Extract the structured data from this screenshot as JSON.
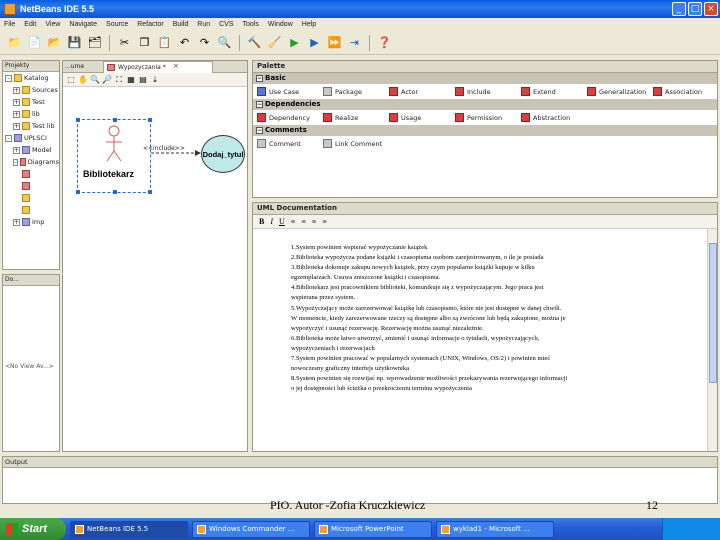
{
  "window": {
    "title": "NetBeans IDE 5.5",
    "min": "_",
    "max": "□",
    "close": "×"
  },
  "menu": [
    "File",
    "Edit",
    "View",
    "Navigate",
    "Source",
    "Refactor",
    "Build",
    "Run",
    "CVS",
    "Tools",
    "Window",
    "Help"
  ],
  "toolbar": {
    "icons": [
      "new-project-icon",
      "new-file-icon",
      "open-project-icon",
      "save-icon",
      "save-all-icon",
      "cut-icon",
      "copy-icon",
      "paste-icon",
      "undo-icon",
      "redo-icon",
      "find-icon",
      "build-icon",
      "clean-build-icon",
      "run-icon",
      "debug-icon",
      "profile-icon",
      "step-icon",
      "help-icon"
    ]
  },
  "projects": {
    "header": "Projekty",
    "rows": [
      {
        "exp": "-",
        "icon": "folder",
        "label": "Katalog"
      },
      {
        "exp": "+",
        "icon": "folder",
        "label": "Sources"
      },
      {
        "exp": "+",
        "icon": "folder",
        "label": "Test"
      },
      {
        "exp": "+",
        "icon": "folder",
        "label": "lib"
      },
      {
        "exp": "+",
        "icon": "folder",
        "label": "Test lib"
      },
      {
        "exp": "-",
        "icon": "pkg",
        "label": "UPLSCI"
      },
      {
        "exp": "+",
        "icon": "pkg",
        "label": "Model"
      },
      {
        "exp": "-",
        "icon": "diag",
        "label": "Diagrams"
      },
      {
        "exp": "",
        "icon": "diag",
        "label": ""
      },
      {
        "exp": "",
        "icon": "diag",
        "label": ""
      },
      {
        "exp": "",
        "icon": "folder",
        "label": ""
      },
      {
        "exp": "",
        "icon": "folder",
        "label": ""
      },
      {
        "exp": "+",
        "icon": "pkg",
        "label": "Imp"
      }
    ]
  },
  "navigator": {
    "header": "Do...",
    "empty": "<No View Av...>"
  },
  "editor": {
    "tab_left": "...ume",
    "tab_label": "Wypozyczania *",
    "tab_close": "×",
    "diagram": {
      "actor": "Bibliotekarz",
      "relation": "<<include>>",
      "usecase": "Dodaj_tytul"
    }
  },
  "palette": {
    "title": "Palette",
    "categories": [
      {
        "name": "Basic",
        "items": [
          {
            "label": "Use Case",
            "icon": "blue"
          },
          {
            "label": "Package",
            "icon": "gray"
          },
          {
            "label": "Actor",
            "icon": "red"
          },
          {
            "label": "Include",
            "icon": "red"
          },
          {
            "label": "Extend",
            "icon": "red"
          },
          {
            "label": "Generalization",
            "icon": "red"
          },
          {
            "label": "Association",
            "icon": "red"
          }
        ]
      },
      {
        "name": "Dependencies",
        "items": [
          {
            "label": "Dependency",
            "icon": "red"
          },
          {
            "label": "Realize",
            "icon": "red"
          },
          {
            "label": "Usage",
            "icon": "red"
          },
          {
            "label": "Permission",
            "icon": "red"
          },
          {
            "label": "Abstraction",
            "icon": "red"
          }
        ]
      },
      {
        "name": "Comments",
        "items": [
          {
            "label": "Comment",
            "icon": "gray"
          },
          {
            "label": "Link Comment",
            "icon": "gray"
          }
        ]
      }
    ]
  },
  "umldoc": {
    "title": "UML Documentation",
    "format_buttons": [
      "B",
      "I",
      "U",
      "≡",
      "≡",
      "≡",
      "≡"
    ],
    "lines": [
      "1.System powinien wspierać wypożyczanie książek",
      "2.Biblioteka wypożycza podane książki i czasopisma osobom zarejestrowanym, o ile je posiada",
      "3.Biblioteka dokonuje zakupu nowych książek, przy czym popularne książki kupuje w kilku",
      "egzemplarzach. Usuwa zniszczone książki i czasopisma.",
      "4.Bibliotekarz jest pracownikiem biblioteki, komunikuje się z wypożyczającym. Jego praca jest",
      "wspierana przez system.",
      "5.Wypożyczający może zarezerwować książkę lub czasopismo, które nie jest dostępne w danej chwili.",
      "W momencie, kiedy zarezerwowane rzeczy są dostępne albo są zwrócone lub będą zakupione, można je",
      "wypożyczyć i usunąć rezerwację. Rezerwację można usunąć niezależnie.",
      "6.Biblioteka może łatwo utworzyć, zmienić i usunąć informacje o tytułach, wypożyczających,",
      "wypożyczeniach i rezerwacjach",
      "7.System powinien pracować w popularnych systemach (UNIX, Windows, OS/2) i powinien mieć",
      "nowoczesny graficzny interfejs użytkownika",
      "8.System powinien się rozwijać np. wprowadzenie możliwości przekazywania rezerwującego informacji",
      "o jej dostępności lub ścieżka o przekroczeniu terminu wypożyczenia"
    ]
  },
  "output": {
    "header": "Output"
  },
  "footer": {
    "author": "PIO. Autor -Zofia Kruczkiewicz",
    "page": "12"
  },
  "taskbar": {
    "start": "Start",
    "tasks": [
      "NetBeans IDE 5.5",
      "Windows Commander ...",
      "Microsoft PowerPoint",
      "wyklad1 - Microsoft ..."
    ]
  }
}
